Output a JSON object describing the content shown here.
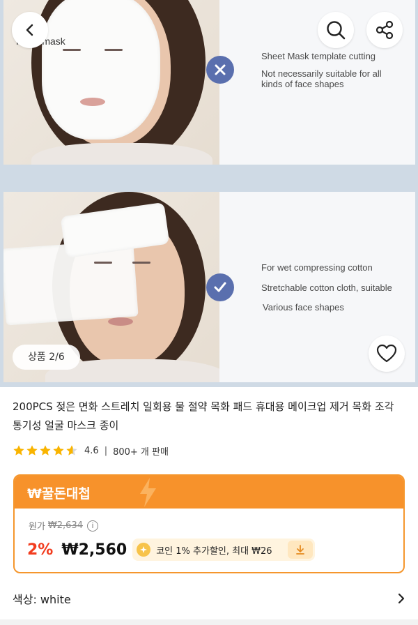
{
  "gallery": {
    "top_panel": {
      "title": "Flaky mask",
      "line1": "Sheet Mask template cutting",
      "line2a": "Not necessarily suitable for all",
      "line2b": "kinds of face shapes"
    },
    "bottom_panel": {
      "title": "For wet compressing cotton",
      "line1": "Stretchable cotton cloth, suitable",
      "line2": "Various face shapes"
    },
    "counter": "상품 2/6"
  },
  "product": {
    "title": "200PCS 젖은 면화 스트레치 일회용 물 절약 목화 패드 휴대용 메이크업 제거 목화 조각 통기성 얼굴 마스크 종이",
    "rating": 4.6,
    "rating_text": "4.6",
    "sold": "800+ 개 판매"
  },
  "deal": {
    "label": "₩꿀돈대첩",
    "orig_label": "원가",
    "orig_price": "₩2,634",
    "info_icon": "i",
    "discount": "2%",
    "price": "₩2,560",
    "coin_text": "코인 1% 추가할인, 최대 ₩26",
    "accent": "#f7922b"
  },
  "option": {
    "label": "색상: white"
  },
  "icons": [
    "back-icon",
    "search-icon",
    "share-icon",
    "heart-icon",
    "star-icon",
    "lightning-icon",
    "coin-icon",
    "download-icon",
    "chevron-right-icon",
    "info-icon",
    "x-icon",
    "check-icon"
  ]
}
